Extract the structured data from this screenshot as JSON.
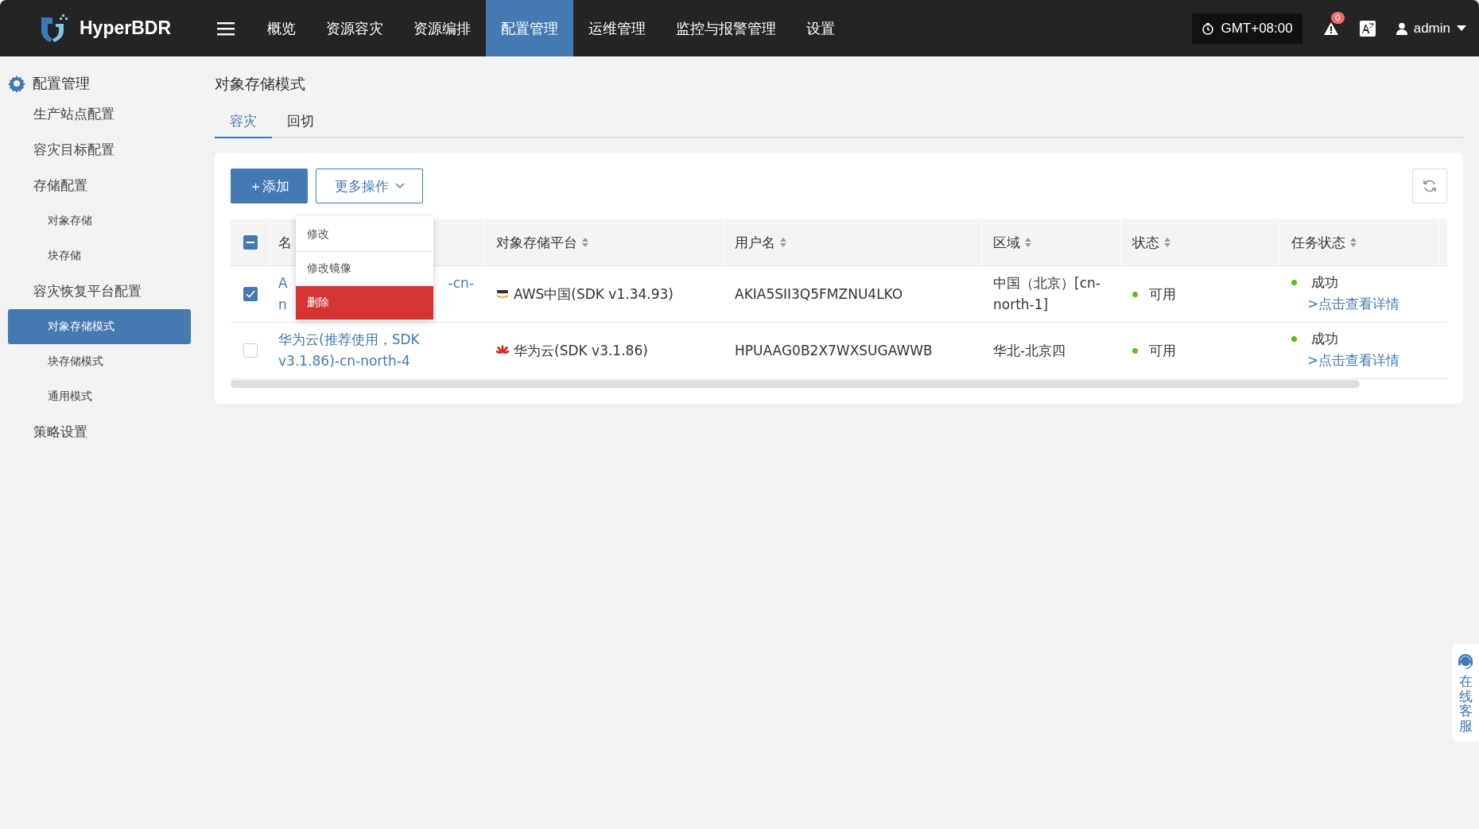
{
  "brand": "HyperBDR",
  "nav": [
    {
      "label": "概览",
      "selected": false
    },
    {
      "label": "资源容灾",
      "selected": false
    },
    {
      "label": "资源编排",
      "selected": false
    },
    {
      "label": "配置管理",
      "selected": true
    },
    {
      "label": "运维管理",
      "selected": false
    },
    {
      "label": "监控与报警管理",
      "selected": false
    },
    {
      "label": "设置",
      "selected": false
    }
  ],
  "timezone": "GMT+08:00",
  "alert_count": "0",
  "user": "admin",
  "sidebar": {
    "title": "配置管理",
    "items": [
      {
        "label": "生产站点配置",
        "selected": false
      },
      {
        "label": "容灾目标配置",
        "selected": false
      },
      {
        "label": "存储配置",
        "selected": false,
        "children": [
          {
            "label": "对象存储",
            "selected": false
          },
          {
            "label": "块存储",
            "selected": false
          }
        ]
      },
      {
        "label": "容灾恢复平台配置",
        "selected": false,
        "children": [
          {
            "label": "对象存储模式",
            "selected": true
          },
          {
            "label": "块存储模式",
            "selected": false
          },
          {
            "label": "通用模式",
            "selected": false
          }
        ]
      },
      {
        "label": "策略设置",
        "selected": false
      }
    ]
  },
  "page_title": "对象存储模式",
  "tabs": [
    {
      "label": "容灾",
      "selected": true
    },
    {
      "label": "回切",
      "selected": false
    }
  ],
  "add_button": "＋添加",
  "more_button": "更多操作",
  "menu": [
    {
      "label": "修改",
      "selected": false
    },
    {
      "label": "修改镜像",
      "selected": false
    },
    {
      "label": "删除",
      "selected": true
    }
  ],
  "table": {
    "select_all_partial": true,
    "columns": [
      "名",
      "对象存储平台",
      "用户名",
      "区域",
      "状态",
      "任务状态"
    ],
    "rows": [
      {
        "checked": true,
        "name_parts": [
          "A",
          "-cn-",
          "n"
        ],
        "platform": "AWS中国(SDK v1.34.93)",
        "kind": "aws",
        "username": "AKIA5SII3Q5FMZNU4LKO",
        "region": "中国（北京）[cn-north-1]",
        "status": "可用",
        "task": "成功",
        "link": ">点击查看详情"
      },
      {
        "checked": false,
        "name": "华为云(推荐使用，SDK v3.1.86)-cn-north-4",
        "platform": "华为云(SDK v3.1.86)",
        "kind": "huawei",
        "username": "HPUAAG0B2X7WXSUGAWWB",
        "region": "华北-北京四",
        "status": "可用",
        "task": "成功",
        "link": ">点击查看详情"
      }
    ]
  },
  "support": "在线客服"
}
